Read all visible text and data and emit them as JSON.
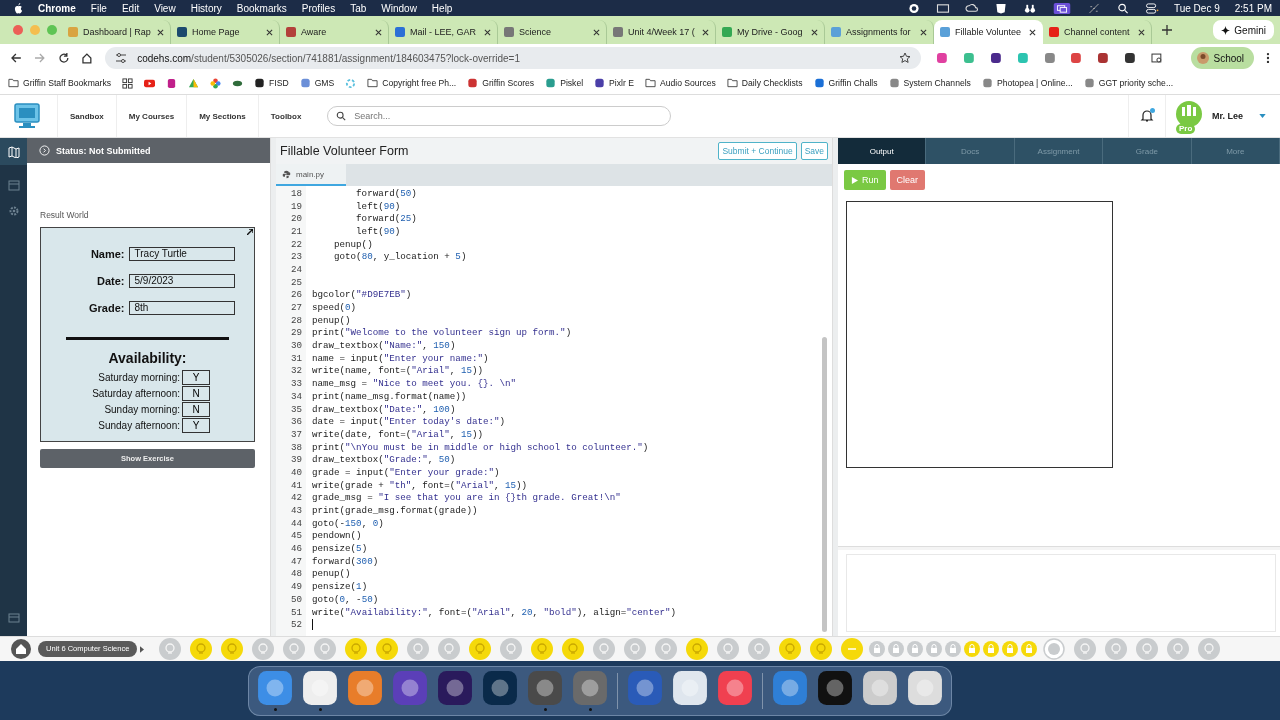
{
  "menu_bar": {
    "app": "Chrome",
    "items": [
      "File",
      "Edit",
      "View",
      "History",
      "Bookmarks",
      "Profiles",
      "Tab",
      "Window",
      "Help"
    ],
    "date": "Tue Dec 9",
    "time": "2:51 PM"
  },
  "browser_tabs": [
    {
      "title": "Dashboard | Rap",
      "selected": false
    },
    {
      "title": "Home Page",
      "selected": false
    },
    {
      "title": "Aware",
      "selected": false
    },
    {
      "title": "Mail - LEE, GAR",
      "selected": false
    },
    {
      "title": "Science",
      "selected": false
    },
    {
      "title": "Unit 4/Week 17 (",
      "selected": false
    },
    {
      "title": "My Drive - Goog",
      "selected": false
    },
    {
      "title": "Assignments for",
      "selected": false
    },
    {
      "title": "Fillable Voluntee",
      "selected": true
    },
    {
      "title": "Channel content",
      "selected": false
    }
  ],
  "gemini": "Gemini",
  "address_bar": {
    "url_host": "codehs.com",
    "url_path": "/student/5305026/section/741881/assignment/184603475?lock-override=1"
  },
  "profile": "School",
  "bookmarks": [
    {
      "label": "Griffin Staff Bookmarks",
      "kind": "folder"
    },
    {
      "label": "FISD",
      "kind": "site"
    },
    {
      "label": "GMS",
      "kind": "site"
    },
    {
      "label": "Copyright free Ph...",
      "kind": "folder"
    },
    {
      "label": "Griffin Scores",
      "kind": "site"
    },
    {
      "label": "Piskel",
      "kind": "site"
    },
    {
      "label": "Pixlr E",
      "kind": "site"
    },
    {
      "label": "Audio Sources",
      "kind": "folder"
    },
    {
      "label": "Daily Checklists",
      "kind": "folder"
    },
    {
      "label": "Griffin Challs",
      "kind": "site"
    },
    {
      "label": "System Channels",
      "kind": "site"
    },
    {
      "label": "Photopea | Online...",
      "kind": "site"
    },
    {
      "label": "GGT priority sche...",
      "kind": "site"
    }
  ],
  "site_nav": {
    "items": [
      "Sandbox",
      "My Courses",
      "My Sections",
      "Toolbox"
    ],
    "search_placeholder": "Search...",
    "user": "Mr. Lee",
    "avatar_badge": "Pro",
    "notification": true
  },
  "status": "Status: Not Submitted",
  "result_world": {
    "title": "Result World",
    "fields": [
      {
        "label": "Name:",
        "value": "Tracy Turtle"
      },
      {
        "label": "Date:",
        "value": "5/9/2023"
      },
      {
        "label": "Grade:",
        "value": "8th"
      }
    ],
    "availability_title": "Availability:",
    "slots": [
      {
        "label": "Saturday morning:",
        "value": "Y"
      },
      {
        "label": "Saturday afternoon:",
        "value": "N"
      },
      {
        "label": "Sunday morning:",
        "value": "N"
      },
      {
        "label": "Sunday afternoon:",
        "value": "Y"
      }
    ],
    "button": "Show Exercise"
  },
  "editor": {
    "title": "Fillable Volunteer Form",
    "buttons": [
      "Submit + Continue",
      "Save"
    ],
    "file_tab": {
      "label": "main.py",
      "selected": true
    },
    "lines": [
      {
        "number": "18",
        "text": "        forward(50)",
        "cursor": false
      },
      {
        "number": "19",
        "text": "        left(90)",
        "cursor": false
      },
      {
        "number": "20",
        "text": "        forward(25)",
        "cursor": false
      },
      {
        "number": "21",
        "text": "        left(90)",
        "cursor": false
      },
      {
        "number": "22",
        "text": "    penup()",
        "cursor": false
      },
      {
        "number": "23",
        "text": "    goto(80, y_location + 5)",
        "cursor": false
      },
      {
        "number": "24",
        "cursor": false
      },
      {
        "number": "25",
        "cursor": false
      },
      {
        "number": "26",
        "text": "bgcolor(\"#D9E7EB\")",
        "cursor": false
      },
      {
        "number": "27",
        "text": "speed(0)",
        "cursor": false
      },
      {
        "number": "28",
        "text": "penup()",
        "cursor": false
      },
      {
        "number": "29",
        "text": "print(\"Welcome to the volunteer sign up form.\")",
        "cursor": false
      },
      {
        "number": "30",
        "text": "draw_textbox(\"Name:\", 150)",
        "cursor": false
      },
      {
        "number": "31",
        "text": "name = input(\"Enter your name:\")",
        "cursor": false
      },
      {
        "number": "32",
        "text": "write(name, font=(\"Arial\", 15))",
        "cursor": false
      },
      {
        "number": "33",
        "text": "name_msg = \"Nice to meet you. {}. \\n\"",
        "cursor": false
      },
      {
        "number": "34",
        "text": "print(name_msg.format(name))",
        "cursor": false
      },
      {
        "number": "35",
        "text": "draw_textbox(\"Date:\", 100)",
        "cursor": false
      },
      {
        "number": "36",
        "text": "date = input(\"Enter today's date:\")",
        "cursor": false
      },
      {
        "number": "37",
        "text": "write(date, font=(\"Arial\", 15))",
        "cursor": false
      },
      {
        "number": "38",
        "text": "print(\"\\nYou must be in middle or high school to colunteer.\")",
        "cursor": false
      },
      {
        "number": "39",
        "text": "draw_textbox(\"Grade:\", 50)",
        "cursor": false
      },
      {
        "number": "40",
        "text": "grade = input(\"Enter your grade:\")",
        "cursor": false
      },
      {
        "number": "41",
        "text": "write(grade + \"th\", font=(\"Arial\", 15))",
        "cursor": false
      },
      {
        "number": "42",
        "text": "grade_msg = \"I see that you are in {}th grade. Great!\\n\"",
        "cursor": false
      },
      {
        "number": "43",
        "text": "print(grade_msg.format(grade))",
        "cursor": false
      },
      {
        "number": "44",
        "text": "goto(-150, 0)",
        "cursor": false
      },
      {
        "number": "45",
        "text": "pendown()",
        "cursor": false
      },
      {
        "number": "46",
        "text": "pensize(5)",
        "cursor": false
      },
      {
        "number": "47",
        "text": "forward(300)",
        "cursor": false
      },
      {
        "number": "48",
        "text": "penup()",
        "cursor": false
      },
      {
        "number": "49",
        "text": "pensize(1)",
        "cursor": false
      },
      {
        "number": "50",
        "text": "goto(0, -50)",
        "cursor": false
      },
      {
        "number": "51",
        "text": "write(\"Availability:\", font=(\"Arial\", 20, \"bold\"), align=\"center\")",
        "cursor": false
      },
      {
        "number": "52",
        "cursor": true
      }
    ]
  },
  "output_tabs": [
    {
      "label": "Output",
      "selected": true
    },
    {
      "label": "Docs",
      "selected": false
    },
    {
      "label": "Assignment",
      "selected": false
    },
    {
      "label": "Grade",
      "selected": false
    },
    {
      "label": "More",
      "selected": false
    }
  ],
  "output_buttons": [
    "Run",
    "Clear"
  ],
  "progress": {
    "unit": "Unit 6 Computer Science",
    "items": [
      {
        "kind": "lesson",
        "done": false
      },
      {
        "kind": "lesson",
        "done": true
      },
      {
        "kind": "lesson",
        "done": true
      },
      {
        "kind": "lesson",
        "done": false
      },
      {
        "kind": "lesson",
        "done": false
      },
      {
        "kind": "lesson",
        "done": false
      },
      {
        "kind": "lesson",
        "done": true
      },
      {
        "kind": "lesson",
        "done": true
      },
      {
        "kind": "lesson",
        "done": false
      },
      {
        "kind": "lesson",
        "done": false
      },
      {
        "kind": "lesson",
        "done": true
      },
      {
        "kind": "lesson",
        "done": false
      },
      {
        "kind": "lesson",
        "done": true
      },
      {
        "kind": "lesson",
        "done": true
      },
      {
        "kind": "lesson",
        "done": false
      },
      {
        "kind": "lesson",
        "done": false
      },
      {
        "kind": "lesson",
        "done": false
      },
      {
        "kind": "lesson",
        "done": true
      },
      {
        "kind": "lesson",
        "done": false
      },
      {
        "kind": "lesson",
        "done": false
      },
      {
        "kind": "lesson",
        "done": true
      },
      {
        "kind": "lesson",
        "done": true
      },
      {
        "kind": "current",
        "done": true
      },
      {
        "kind": "locked",
        "done": false
      },
      {
        "kind": "locked",
        "done": false
      },
      {
        "kind": "locked",
        "done": false
      },
      {
        "kind": "locked",
        "done": false
      },
      {
        "kind": "locked",
        "done": false
      },
      {
        "kind": "locked",
        "done": true
      },
      {
        "kind": "locked",
        "done": true
      },
      {
        "kind": "locked",
        "done": true
      },
      {
        "kind": "locked",
        "done": true
      },
      {
        "kind": "milestone",
        "done": false
      },
      {
        "kind": "lesson",
        "done": false
      },
      {
        "kind": "lesson",
        "done": false
      },
      {
        "kind": "lesson",
        "done": false
      },
      {
        "kind": "lesson",
        "done": false
      },
      {
        "kind": "lesson",
        "done": false
      }
    ]
  },
  "dock": [
    {
      "running": true
    },
    {
      "running": true
    },
    {
      "running": false
    },
    {
      "running": false
    },
    {
      "running": false
    },
    {
      "running": false
    },
    {
      "running": true
    },
    {
      "running": true
    },
    {
      "running": false
    },
    {
      "running": false
    },
    {
      "running": false
    },
    {
      "running": false
    },
    {
      "running": false
    },
    {
      "running": false
    },
    {
      "running": false
    }
  ]
}
